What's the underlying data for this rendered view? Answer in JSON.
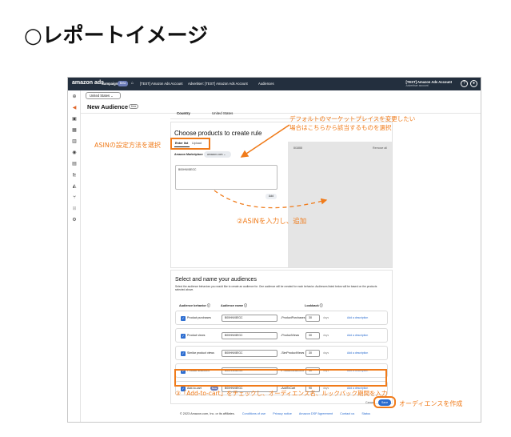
{
  "heading": "○レポートイメージ",
  "topbar": {
    "logo": "amazon ads",
    "campaigns": "Campaigns",
    "campaigns_badge": "Beta",
    "crumbs": [
      "[TEST] Amazon Ads Account",
      "Advertiser: [TEST] Amazon Ads Account",
      "Audiences"
    ],
    "account_name": "[TEST] Amazon Ads Account",
    "account_sub": "Advertiser account",
    "help_icon": "help-icon",
    "user_icon": "user-icon"
  },
  "sidebar": {
    "icons": [
      "plus-icon",
      "megaphone-icon",
      "briefcase-icon",
      "grid-icon",
      "store-icon",
      "shield-icon",
      "image-icon",
      "chart-icon",
      "measure-icon",
      "integrations-icon",
      "apps-icon",
      "settings-icon"
    ]
  },
  "country_select": "United States",
  "page": {
    "title": "New Audience",
    "badge": "Beta"
  },
  "country_row": {
    "label": "Country",
    "value": "United States"
  },
  "products": {
    "title": "Choose products to create rule",
    "tabs": [
      "Enter list",
      "Upload"
    ],
    "marketplace_label": "Amazon Marketplace",
    "marketplace_value": "amazon.com",
    "asin_text": "B00HNV8EGC",
    "add_label": "Add",
    "count": "0/1000",
    "remove_all": "Remove all"
  },
  "audiences": {
    "title": "Select and name your audiences",
    "description": "Select the audience behaviors you would like to create an audience for. One audience will be created for each behavior. Audiences listed below will be based on the products selected above.",
    "col_behavior": "Audience behavior",
    "col_name": "Audience name",
    "col_lookback": "Lookback",
    "rows": [
      {
        "behavior": "Product purchases",
        "name": "B00HNV8EGC",
        "suffix": "-ProductPurchases",
        "lookback": "30",
        "unit": "days",
        "link": "Add a description"
      },
      {
        "behavior": "Product views",
        "name": "B00HNV8EGC",
        "suffix": "-ProductViews",
        "lookback": "30",
        "unit": "days",
        "link": "Add a description"
      },
      {
        "behavior": "Similar product views",
        "name": "B00HNV8EGC",
        "suffix": "-SimProductViews",
        "lookback": "30",
        "unit": "days",
        "link": "Add a description"
      },
      {
        "behavior": "Product searches",
        "name": "B00HNV8EGC",
        "suffix": "-ProductSearches",
        "lookback": "30",
        "unit": "days",
        "link": "Add a description"
      },
      {
        "behavior": "Add-to-cart",
        "badge": "Beta",
        "name": "B00HNV8EGC",
        "suffix": "-AddToCart",
        "lookback": "90",
        "unit": "days",
        "link": "Add a description"
      }
    ]
  },
  "actions": {
    "cancel": "Cancel",
    "save": "Save"
  },
  "footer": {
    "copyright": "© 2023 Amazon.com, Inc. or its affiliates.",
    "links": [
      "Conditions of use",
      "Privacy notice",
      "Amazon DSP Agreement",
      "Contact us",
      "Status"
    ]
  },
  "annotations": {
    "asin_method": "ASINの設定方法を選択",
    "marketplace_line1": "デフォルトのマーケットプレイスを変更したい",
    "marketplace_line2": "場合はこちらから該当するものを選択",
    "step2": "②ASINを入力し、追加",
    "step3": "③「Add-to-cart」をチェックし、オーディエンス名、ルックバック期間を入力",
    "create": "オーディエンスを作成",
    "color": "#f07b1a"
  }
}
